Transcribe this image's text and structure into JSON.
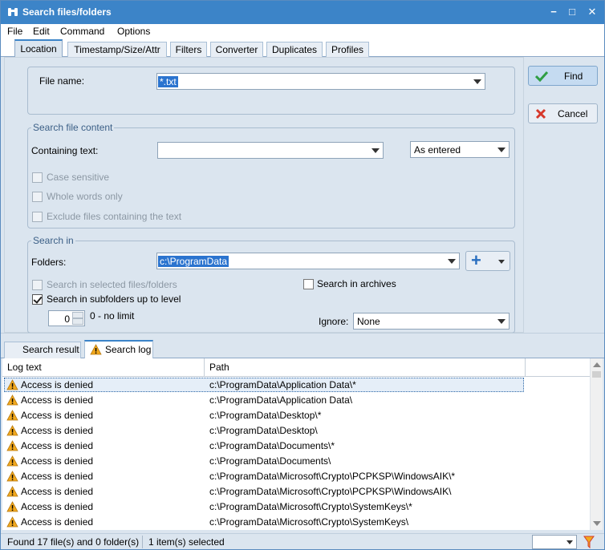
{
  "window": {
    "title": "Search files/folders",
    "minimize_glyph": "−",
    "maximize_glyph": "□",
    "close_glyph": "✕"
  },
  "menu": [
    "File",
    "Edit",
    "Command",
    "Options"
  ],
  "tabs": [
    "Location",
    "Timestamp/Size/Attr",
    "Filters",
    "Converter",
    "Duplicates",
    "Profiles"
  ],
  "location": {
    "file_name_label": "File name:",
    "file_name_value": "*.txt"
  },
  "content": {
    "group_title": "Search file content",
    "containing_label": "Containing text:",
    "containing_value": "",
    "mode_value": "As entered",
    "case_sensitive": "Case sensitive",
    "whole_words": "Whole words only",
    "exclude": "Exclude files containing the text"
  },
  "search_in": {
    "group_title": "Search in",
    "folders_label": "Folders:",
    "folders_value": "c:\\ProgramData",
    "add_glyph": "+",
    "selected_label": "Search in selected files/folders",
    "archives_label": "Search in archives",
    "subfolders_label": "Search in subfolders up to level",
    "level_value": "0",
    "level_hint": "0 - no limit",
    "ignore_label": "Ignore:",
    "ignore_value": "None"
  },
  "buttons": {
    "find": "Find",
    "cancel": "Cancel"
  },
  "result_tabs": [
    "Search result",
    "Search log"
  ],
  "columns": [
    "Log text",
    "Path"
  ],
  "log_rows": [
    {
      "log": "Access is denied",
      "path": "c:\\ProgramData\\Application Data\\*"
    },
    {
      "log": "Access is denied",
      "path": "c:\\ProgramData\\Application Data\\"
    },
    {
      "log": "Access is denied",
      "path": "c:\\ProgramData\\Desktop\\*"
    },
    {
      "log": "Access is denied",
      "path": "c:\\ProgramData\\Desktop\\"
    },
    {
      "log": "Access is denied",
      "path": "c:\\ProgramData\\Documents\\*"
    },
    {
      "log": "Access is denied",
      "path": "c:\\ProgramData\\Documents\\"
    },
    {
      "log": "Access is denied",
      "path": "c:\\ProgramData\\Microsoft\\Crypto\\PCPKSP\\WindowsAIK\\*"
    },
    {
      "log": "Access is denied",
      "path": "c:\\ProgramData\\Microsoft\\Crypto\\PCPKSP\\WindowsAIK\\"
    },
    {
      "log": "Access is denied",
      "path": "c:\\ProgramData\\Microsoft\\Crypto\\SystemKeys\\*"
    },
    {
      "log": "Access is denied",
      "path": "c:\\ProgramData\\Microsoft\\Crypto\\SystemKeys\\"
    }
  ],
  "status": {
    "found": "Found 17 file(s) and 0 folder(s)",
    "selected": "1 item(s) selected"
  },
  "colors": {
    "title_bar": "#3c84c8",
    "panel": "#dbe5ef",
    "selection": "#2b74cf",
    "warning": "#f2a91e"
  }
}
